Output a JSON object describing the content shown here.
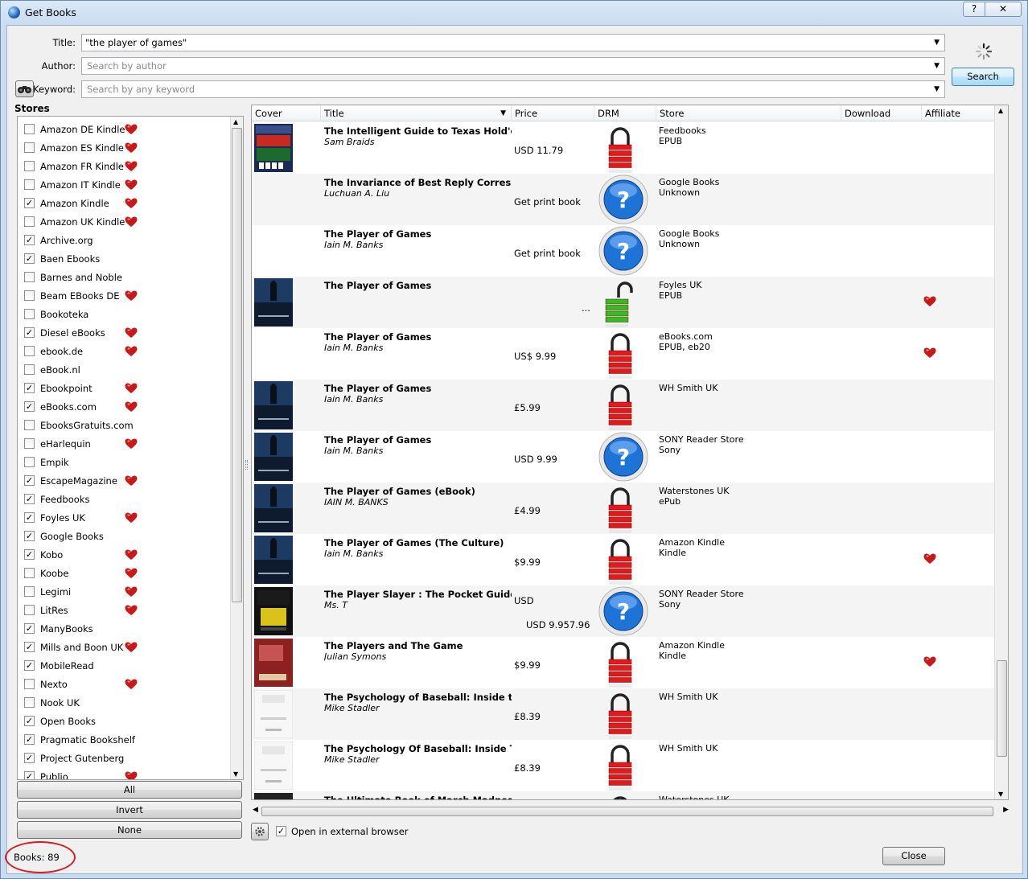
{
  "window": {
    "title": "Get Books",
    "help_label": "?",
    "close_label": "✕"
  },
  "form": {
    "title_label": "Title:",
    "title_value": "\"the player of games\"",
    "author_label": "Author:",
    "author_placeholder": "Search by author",
    "keyword_label": "Keyword:",
    "keyword_placeholder": "Search by any keyword",
    "search_button": "Search"
  },
  "stores": {
    "label": "Stores",
    "items": [
      {
        "name": "Amazon DE Kindle",
        "checked": false,
        "affiliate": true
      },
      {
        "name": "Amazon ES Kindle",
        "checked": false,
        "affiliate": true
      },
      {
        "name": "Amazon FR Kindle",
        "checked": false,
        "affiliate": true
      },
      {
        "name": "Amazon IT Kindle",
        "checked": false,
        "affiliate": true
      },
      {
        "name": "Amazon Kindle",
        "checked": true,
        "affiliate": true
      },
      {
        "name": "Amazon UK Kindle",
        "checked": false,
        "affiliate": true
      },
      {
        "name": "Archive.org",
        "checked": true,
        "affiliate": false
      },
      {
        "name": "Baen Ebooks",
        "checked": true,
        "affiliate": false
      },
      {
        "name": "Barnes and Noble",
        "checked": false,
        "affiliate": false
      },
      {
        "name": "Beam EBooks DE",
        "checked": false,
        "affiliate": true
      },
      {
        "name": "Bookoteka",
        "checked": false,
        "affiliate": false
      },
      {
        "name": "Diesel eBooks",
        "checked": true,
        "affiliate": true
      },
      {
        "name": "ebook.de",
        "checked": false,
        "affiliate": true
      },
      {
        "name": "eBook.nl",
        "checked": false,
        "affiliate": false
      },
      {
        "name": "Ebookpoint",
        "checked": true,
        "affiliate": true
      },
      {
        "name": "eBooks.com",
        "checked": true,
        "affiliate": true
      },
      {
        "name": "EbooksGratuits.com",
        "checked": false,
        "affiliate": false
      },
      {
        "name": "eHarlequin",
        "checked": false,
        "affiliate": true
      },
      {
        "name": "Empik",
        "checked": false,
        "affiliate": false
      },
      {
        "name": "EscapeMagazine",
        "checked": true,
        "affiliate": true
      },
      {
        "name": "Feedbooks",
        "checked": true,
        "affiliate": false
      },
      {
        "name": "Foyles UK",
        "checked": true,
        "affiliate": true
      },
      {
        "name": "Google Books",
        "checked": true,
        "affiliate": false
      },
      {
        "name": "Kobo",
        "checked": true,
        "affiliate": true
      },
      {
        "name": "Koobe",
        "checked": false,
        "affiliate": true
      },
      {
        "name": "Legimi",
        "checked": false,
        "affiliate": true
      },
      {
        "name": "LitRes",
        "checked": false,
        "affiliate": true
      },
      {
        "name": "ManyBooks",
        "checked": true,
        "affiliate": false
      },
      {
        "name": "Mills and Boon UK",
        "checked": true,
        "affiliate": true
      },
      {
        "name": "MobileRead",
        "checked": true,
        "affiliate": false
      },
      {
        "name": "Nexto",
        "checked": false,
        "affiliate": true
      },
      {
        "name": "Nook UK",
        "checked": false,
        "affiliate": false
      },
      {
        "name": "Open Books",
        "checked": true,
        "affiliate": false
      },
      {
        "name": "Pragmatic Bookshelf",
        "checked": true,
        "affiliate": false
      },
      {
        "name": "Project Gutenberg",
        "checked": true,
        "affiliate": false
      },
      {
        "name": "Publio",
        "checked": true,
        "affiliate": true
      }
    ],
    "all_button": "All",
    "invert_button": "Invert",
    "none_button": "None"
  },
  "results": {
    "columns": [
      "Cover",
      "Title",
      "Price",
      "DRM",
      "Store",
      "Download",
      "Affiliate"
    ],
    "sort_indicator_icon": "chevron-down-icon",
    "rows": [
      {
        "title": "The Intelligent Guide to Texas Hold'em Po",
        "author": "Sam Braids",
        "price": "USD 11.79",
        "drm": "locked",
        "store": "Feedbooks",
        "format": "EPUB",
        "affiliate": false,
        "cover": "poker"
      },
      {
        "title": "The Invariance of Best Reply Corresponde",
        "author": "Luchuan A. Liu",
        "price": "Get print book",
        "drm": "unknown",
        "store": "Google Books",
        "format": "Unknown",
        "affiliate": false,
        "cover": "none"
      },
      {
        "title": "The Player of Games",
        "author": "Iain M. Banks",
        "price": "Get print book",
        "drm": "unknown",
        "store": "Google Books",
        "format": "Unknown",
        "affiliate": false,
        "cover": "none"
      },
      {
        "title": "The Player of Games",
        "author": "",
        "price": "...",
        "drm": "unlocked",
        "store": "Foyles UK",
        "format": "EPUB",
        "affiliate": true,
        "cover": "banks"
      },
      {
        "title": "The Player of Games",
        "author": "Iain M. Banks",
        "price": "US$ 9.99",
        "drm": "locked",
        "store": "eBooks.com",
        "format": "EPUB, eb20",
        "affiliate": true,
        "cover": "none"
      },
      {
        "title": "The Player of Games",
        "author": "Iain M. Banks",
        "price": "£5.99",
        "drm": "locked",
        "store": "WH Smith UK",
        "format": "",
        "affiliate": false,
        "cover": "banks"
      },
      {
        "title": "The Player of Games",
        "author": "Iain M. Banks",
        "price": "USD 9.99",
        "drm": "unknown",
        "store": "SONY Reader Store",
        "format": "Sony",
        "affiliate": false,
        "cover": "banks2"
      },
      {
        "title": "The Player of Games (eBook)",
        "author": "IAIN M. BANKS",
        "price": "£4.99",
        "drm": "locked",
        "store": "Waterstones UK",
        "format": "ePub",
        "affiliate": false,
        "cover": "banks"
      },
      {
        "title": "The Player of Games (The Culture)",
        "author": "Iain M. Banks",
        "price": "$9.99",
        "drm": "locked",
        "store": "Amazon Kindle",
        "format": "Kindle",
        "affiliate": true,
        "cover": "banks3"
      },
      {
        "title": "The Player Slayer : The Pocket Guide to Ja",
        "author": "Ms. T",
        "price": "USD",
        "price2": "USD 9.957.96",
        "drm": "unknown",
        "store": "SONY Reader Store",
        "format": "Sony",
        "affiliate": false,
        "cover": "slayer"
      },
      {
        "title": "The Players and The Game",
        "author": "Julian Symons",
        "price": "$9.99",
        "drm": "locked",
        "store": "Amazon Kindle",
        "format": "Kindle",
        "affiliate": true,
        "cover": "players"
      },
      {
        "title": "The Psychology of Baseball: Inside the Me",
        "author": "Mike Stadler",
        "price": "£8.39",
        "drm": "locked",
        "store": "WH Smith UK",
        "format": "",
        "affiliate": false,
        "cover": "psych"
      },
      {
        "title": "The Psychology Of Baseball: Inside The M",
        "author": "Mike Stadler",
        "price": "£8.39",
        "drm": "locked",
        "store": "WH Smith UK",
        "format": "",
        "affiliate": false,
        "cover": "psych"
      },
      {
        "title": "The Ultimate Book of March Madness (eBo",
        "author": "",
        "price": "",
        "drm": "locked",
        "store": "Waterstones UK",
        "format": "",
        "affiliate": false,
        "cover": "madness"
      }
    ]
  },
  "bottom": {
    "open_external_label": "Open in external browser",
    "open_external_checked": true,
    "books_count_label": "Books:  89",
    "close_button": "Close"
  },
  "colors": {
    "drm_locked": "#e21a1a",
    "drm_unlocked": "#2fbf1f",
    "drm_unknown": "#1e73d6",
    "affiliate_heart": "#c81818",
    "annotation": "#d22020"
  }
}
